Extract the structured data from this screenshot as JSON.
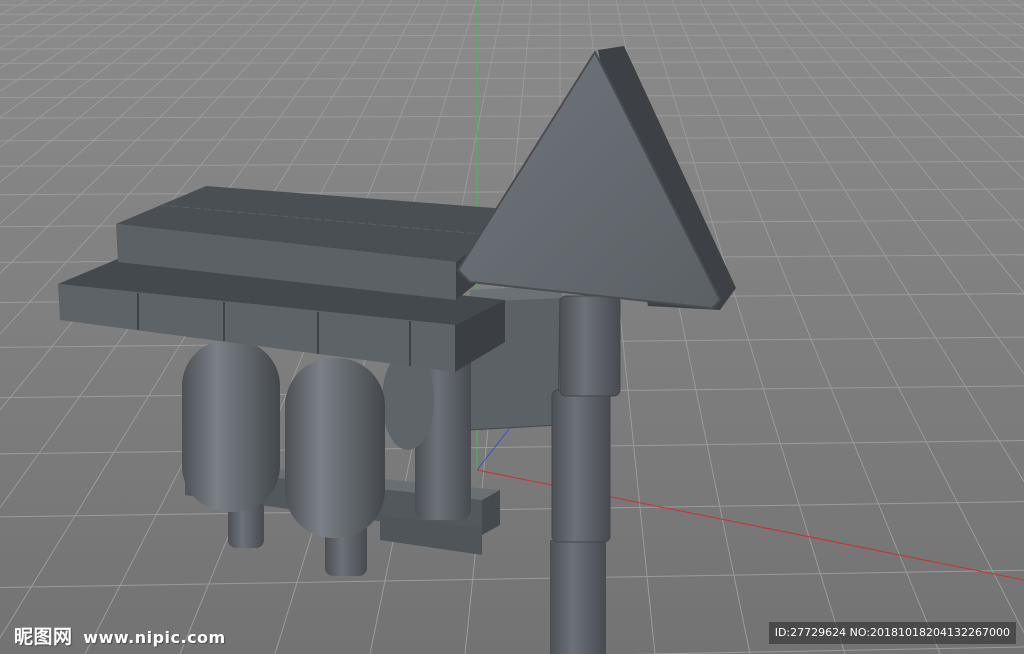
{
  "viewport": {
    "background_color": "#7c7c7c",
    "grid_line_color": "#9a9a9a",
    "y_axis_color": "#3fbf3f",
    "x_axis_color": "#c83232",
    "z_axis_color": "#3a50d0",
    "model_color": "#5f6469"
  },
  "watermark": {
    "site_name": "昵图网",
    "site_url": "www.nipic.com",
    "image_info": "ID:27729624 NO:20181018204132267000"
  },
  "icons": {
    "sign": "triangle-sign-icon"
  }
}
